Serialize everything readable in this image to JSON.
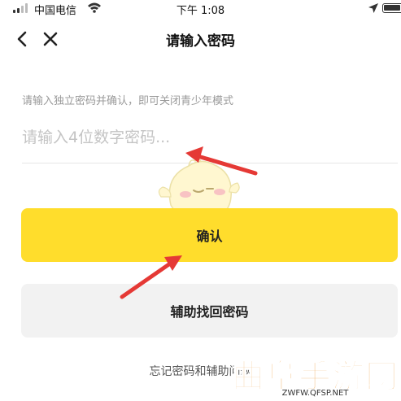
{
  "status_bar": {
    "carrier": "中国电信",
    "time": "下午 1:08",
    "icons": [
      "signal-icon",
      "wifi-icon",
      "location-arrow-icon",
      "battery-icon"
    ]
  },
  "nav": {
    "title": "请输入密码",
    "back_icon": "chevron-left-icon",
    "close_icon": "close-icon"
  },
  "form": {
    "hint": "请输入独立密码并确认，即可关闭青少年模式",
    "password_placeholder": "请输入4位数字密码..."
  },
  "buttons": {
    "confirm_label": "确认",
    "assist_label": "辅助找回密码"
  },
  "footer": {
    "forgot_link": "忘记密码和辅助问题"
  },
  "watermark": {
    "title": "曲阜手游网",
    "url": "ZWFW.QFSP.NET"
  },
  "colors": {
    "accent": "#ffdd2c",
    "secondary_button": "#f2f2f2",
    "annotation_arrow": "#e53935",
    "watermark": "#e88a1a"
  }
}
